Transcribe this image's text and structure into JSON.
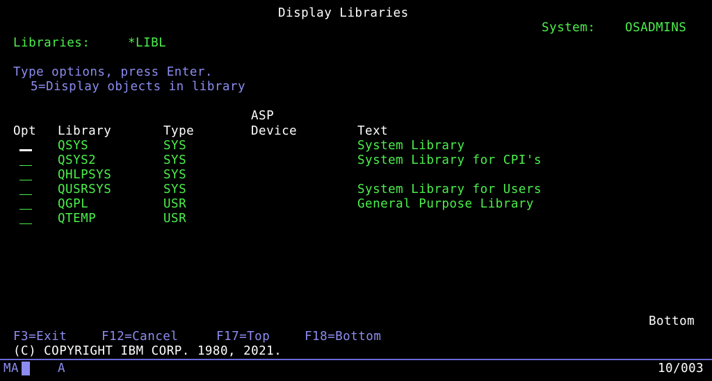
{
  "screen": {
    "title": "Display Libraries",
    "system_label": "System:",
    "system_name": "OSADMINS",
    "libraries_label": "Libraries:",
    "libraries_value": "*LIBL"
  },
  "instructions": {
    "line1": "Type options, press Enter.",
    "line2": "5=Display objects in library"
  },
  "columns": {
    "opt": "Opt",
    "library": "Library",
    "type": "Type",
    "asp_top": "ASP",
    "asp_bottom": "Device",
    "text": "Text"
  },
  "rows": [
    {
      "library": "QSYS",
      "type": "SYS",
      "text": "System Library"
    },
    {
      "library": "QSYS2",
      "type": "SYS",
      "text": "System Library for CPI's"
    },
    {
      "library": "QHLPSYS",
      "type": "SYS",
      "text": ""
    },
    {
      "library": "QUSRSYS",
      "type": "SYS",
      "text": "System Library for Users"
    },
    {
      "library": "QGPL",
      "type": "USR",
      "text": "General Purpose Library"
    },
    {
      "library": "QTEMP",
      "type": "USR",
      "text": ""
    }
  ],
  "more_indicator": "Bottom",
  "function_keys": {
    "f3": "F3=Exit",
    "f12": "F12=Cancel",
    "f17": "F17=Top",
    "f18": "F18=Bottom"
  },
  "copyright": "(C) COPYRIGHT IBM CORP. 1980, 2021.",
  "status_bar": {
    "mode": "MA",
    "indicator": "A",
    "cursor_position": "10/003"
  },
  "colors": {
    "background": "#000000",
    "green": "#4cf04c",
    "white": "#ffffff",
    "blue": "#8c8cf0"
  }
}
